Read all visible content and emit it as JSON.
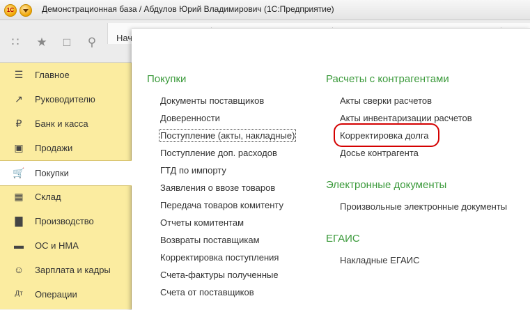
{
  "window": {
    "title": "Демонстрационная база / Абдулов Юрий Владимирович  (1С:Предприятие)",
    "logo_text": "1С"
  },
  "tabs": {
    "home": "Нач"
  },
  "toolbar": {
    "icons": [
      "apps-grid-icon",
      "star-icon",
      "history-icon",
      "search-icon"
    ]
  },
  "sidebar": {
    "items": [
      {
        "label": "Главное",
        "icon": "menu-icon"
      },
      {
        "label": "Руководителю",
        "icon": "trend-icon"
      },
      {
        "label": "Банк и касса",
        "icon": "ruble-icon"
      },
      {
        "label": "Продажи",
        "icon": "bag-icon"
      },
      {
        "label": "Покупки",
        "icon": "cart-icon",
        "active": true
      },
      {
        "label": "Склад",
        "icon": "grid-icon"
      },
      {
        "label": "Производство",
        "icon": "factory-icon"
      },
      {
        "label": "ОС и НМА",
        "icon": "truck-icon"
      },
      {
        "label": "Зарплата и кадры",
        "icon": "person-icon"
      },
      {
        "label": "Операции",
        "icon": "ledger-icon"
      }
    ]
  },
  "panel": {
    "purchases": {
      "title": "Покупки",
      "items": [
        "Документы поставщиков",
        "Доверенности",
        "Поступление (акты, накладные)",
        "Поступление доп. расходов",
        "ГТД по импорту",
        "Заявления о ввозе товаров",
        "Передача товаров комитенту",
        "Отчеты комитентам",
        "Возвраты поставщикам",
        "Корректировка поступления",
        "Счета-фактуры полученные",
        "Счета от поставщиков"
      ]
    },
    "settlements": {
      "title": "Расчеты с контрагентами",
      "items": [
        "Акты сверки расчетов",
        "Акты инвентаризации расчетов",
        "Корректировка долга",
        "Досье контрагента"
      ]
    },
    "edocs": {
      "title": "Электронные документы",
      "items": [
        "Произвольные электронные документы"
      ]
    },
    "egais": {
      "title": "ЕГАИС",
      "items": [
        "Накладные ЕГАИС"
      ]
    }
  },
  "colors": {
    "sidebar_bg": "#fbeca0",
    "group_title": "#3b9a3b",
    "highlight": "#d40000"
  }
}
